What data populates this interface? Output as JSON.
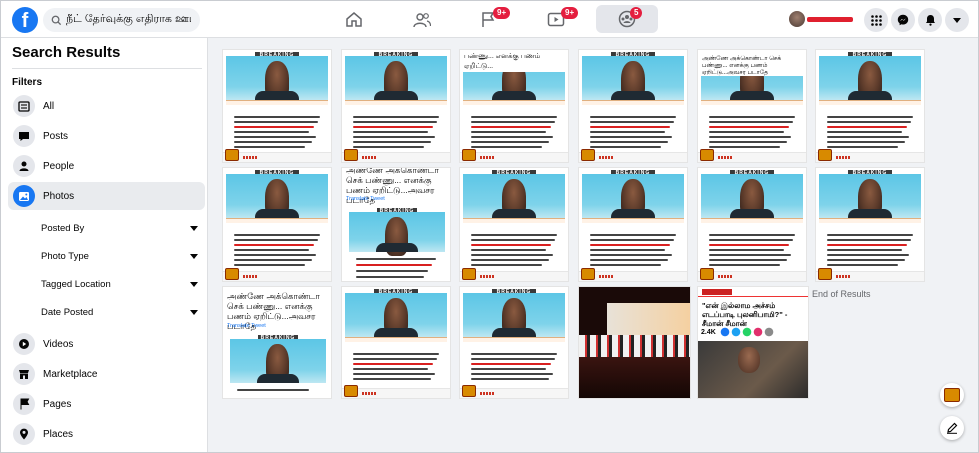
{
  "search": {
    "value": "நீட் தேர்வுக்கு எதிராக ஊடக"
  },
  "nav": {
    "groups_badge": "9+",
    "watch_badge": "9+",
    "gaming_badge": "5"
  },
  "sidebar": {
    "title": "Search Results",
    "filters_label": "Filters",
    "items": [
      {
        "label": "All",
        "icon": "all-icon"
      },
      {
        "label": "Posts",
        "icon": "posts-icon"
      },
      {
        "label": "People",
        "icon": "people-icon"
      },
      {
        "label": "Photos",
        "icon": "photos-icon"
      }
    ],
    "photo_filters": [
      "Posted By",
      "Photo Type",
      "Tagged Location",
      "Date Posted"
    ],
    "more_items": [
      {
        "label": "Videos",
        "icon": "video-icon"
      },
      {
        "label": "Marketplace",
        "icon": "marketplace-icon"
      },
      {
        "label": "Pages",
        "icon": "flag-icon"
      },
      {
        "label": "Places",
        "icon": "pin-icon"
      }
    ]
  },
  "breaking_label": "BREAKING",
  "tweet": {
    "fragment_top": "பண்ணு... எனக்கு பணம் ஏறிட்டு...",
    "text": "அண்ணே அக்கொண்டா செக் பண்ணு... எனக்கு பணம் ஏறிட்டு...அவசர படாதே",
    "translate": "Translate Tweet",
    "text_mid": "அண்ணே அக்கொண்டா செக் பண்ணு... எனக்கு பணம் ஏறிட்டு...அவசர படாதே"
  },
  "news_card": {
    "headline": "\"என் இல்லாம அச்சம் எடப்பாடி புலனிபாமி?\" - சீமான் சீமான்",
    "count": "2.4K"
  },
  "end_of_results": "End of Results",
  "colors": {
    "brand": "#1877f2",
    "badge": "#e41e3f",
    "breaking": "#3a3a3a"
  }
}
